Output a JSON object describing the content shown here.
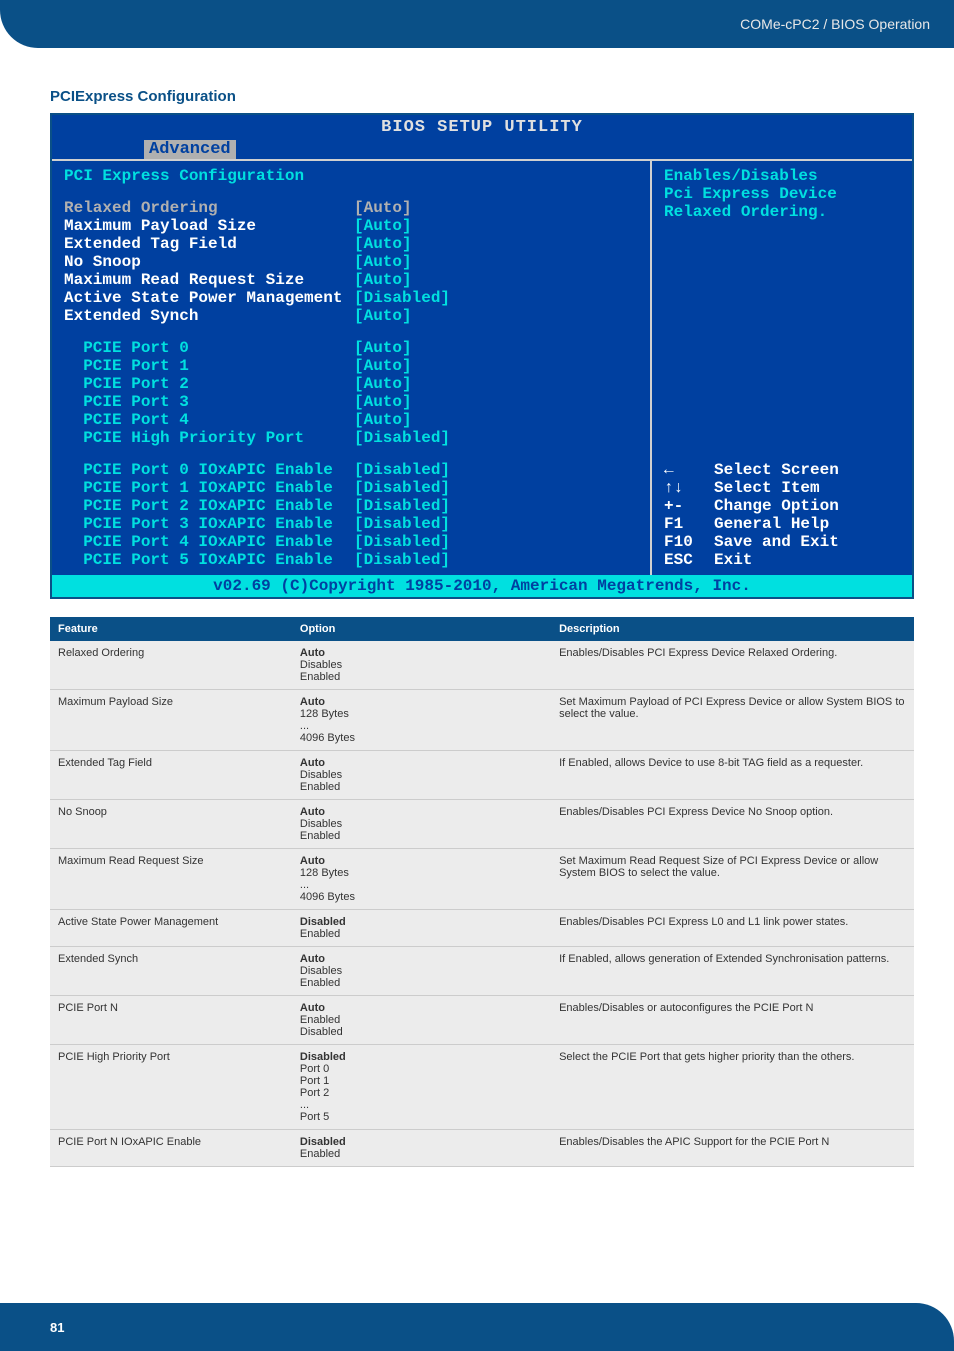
{
  "header": {
    "product": "COMe-cPC2 / BIOS Operation"
  },
  "section": {
    "title": "PCIExpress Configuration"
  },
  "bios": {
    "title": "BIOS SETUP UTILITY",
    "tab": "Advanced",
    "screen_heading": "PCI Express Configuration",
    "help_text_l1": "Enables/Disables",
    "help_text_l2": "Pci Express Device",
    "help_text_l3": "Relaxed Ordering.",
    "rows": [
      {
        "label": "Relaxed Ordering",
        "value": "[Auto]",
        "selected": true
      },
      {
        "label": "Maximum Payload Size",
        "value": "[Auto]"
      },
      {
        "label": "Extended Tag Field",
        "value": "[Auto]"
      },
      {
        "label": "No Snoop",
        "value": "[Auto]"
      },
      {
        "label": "Maximum Read Request Size",
        "value": "[Auto]"
      },
      {
        "label": "Active State Power Management",
        "value": "[Disabled]"
      },
      {
        "label": "Extended Synch",
        "value": "[Auto]"
      }
    ],
    "ports": [
      {
        "label": "  PCIE Port 0",
        "value": "[Auto]"
      },
      {
        "label": "  PCIE Port 1",
        "value": "[Auto]"
      },
      {
        "label": "  PCIE Port 2",
        "value": "[Auto]"
      },
      {
        "label": "  PCIE Port 3",
        "value": "[Auto]"
      },
      {
        "label": "  PCIE Port 4",
        "value": "[Auto]"
      },
      {
        "label": "  PCIE High Priority Port",
        "value": "[Disabled]"
      }
    ],
    "apic": [
      {
        "label": "  PCIE Port 0 IOxAPIC Enable",
        "value": "[Disabled]"
      },
      {
        "label": "  PCIE Port 1 IOxAPIC Enable",
        "value": "[Disabled]"
      },
      {
        "label": "  PCIE Port 2 IOxAPIC Enable",
        "value": "[Disabled]"
      },
      {
        "label": "  PCIE Port 3 IOxAPIC Enable",
        "value": "[Disabled]"
      },
      {
        "label": "  PCIE Port 4 IOxAPIC Enable",
        "value": "[Disabled]"
      },
      {
        "label": "  PCIE Port 5 IOxAPIC Enable",
        "value": "[Disabled]"
      }
    ],
    "nav": [
      {
        "key": "←",
        "desc": "Select Screen"
      },
      {
        "key": "↑↓",
        "desc": "Select Item"
      },
      {
        "key": "+-",
        "desc": "Change Option"
      },
      {
        "key": "F1",
        "desc": "General Help"
      },
      {
        "key": "F10",
        "desc": "Save and Exit"
      },
      {
        "key": "ESC",
        "desc": "Exit"
      }
    ],
    "copyright": "v02.69 (C)Copyright 1985-2010, American Megatrends, Inc."
  },
  "table": {
    "headers": {
      "feature": "Feature",
      "option": "Option",
      "description": "Description"
    },
    "rows": [
      {
        "feature": "Relaxed Ordering",
        "options": [
          "Auto",
          "Disables",
          "Enabled"
        ],
        "bold": 0,
        "desc": "Enables/Disables PCI Express Device Relaxed Ordering."
      },
      {
        "feature": "Maximum Payload Size",
        "options": [
          "Auto",
          "128 Bytes",
          "...",
          "4096 Bytes"
        ],
        "bold": 0,
        "desc": "Set Maximum Payload of PCI Express Device or allow System BIOS to select the value."
      },
      {
        "feature": "Extended Tag Field",
        "options": [
          "Auto",
          "Disables",
          "Enabled"
        ],
        "bold": 0,
        "desc": "If Enabled, allows Device to use 8-bit TAG field as a requester."
      },
      {
        "feature": "No Snoop",
        "options": [
          "Auto",
          "Disables",
          "Enabled"
        ],
        "bold": 0,
        "desc": "Enables/Disables PCI Express Device No Snoop option."
      },
      {
        "feature": "Maximum Read Request Size",
        "options": [
          "Auto",
          "128 Bytes",
          "...",
          "4096 Bytes"
        ],
        "bold": 0,
        "desc": "Set Maximum Read Request Size of PCI Express Device or allow System BIOS to select the value."
      },
      {
        "feature": "Active State Power Management",
        "options": [
          "Disabled",
          "Enabled"
        ],
        "bold": 0,
        "desc": "Enables/Disables PCI Express L0 and L1 link power states."
      },
      {
        "feature": "Extended Synch",
        "options": [
          "Auto",
          "Disables",
          "Enabled"
        ],
        "bold": 0,
        "desc": "If Enabled, allows generation of Extended Synchronisation patterns."
      },
      {
        "feature": "PCIE Port N",
        "options": [
          "Auto",
          "Enabled",
          "Disabled"
        ],
        "bold": 0,
        "desc": "Enables/Disables or autoconfigures the PCIE Port N"
      },
      {
        "feature": "PCIE High Priority Port",
        "options": [
          "Disabled",
          "Port 0",
          "Port 1",
          "Port 2",
          "...",
          "Port 5"
        ],
        "bold": 0,
        "desc": "Select the PCIE Port that gets higher priority than the others."
      },
      {
        "feature": "PCIE Port N IOxAPIC Enable",
        "options": [
          "Disabled",
          "Enabled"
        ],
        "bold": 0,
        "desc": "Enables/Disables the APIC Support for the PCIE Port N"
      }
    ]
  },
  "footer": {
    "page": "81"
  }
}
